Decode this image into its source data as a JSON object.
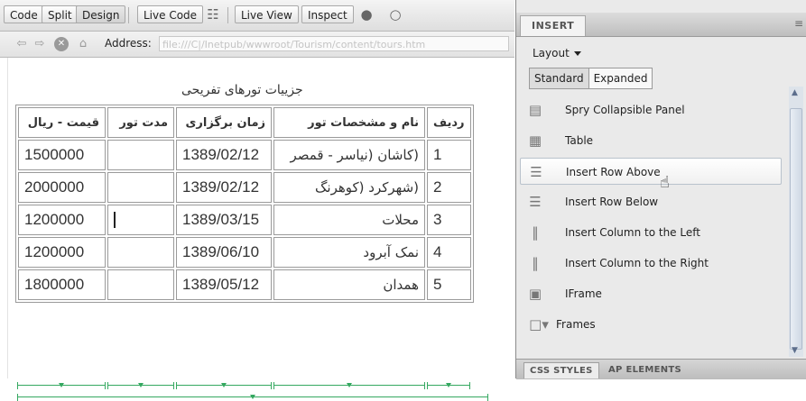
{
  "toolbar": {
    "buttons": [
      "Code",
      "Split",
      "Design",
      "Live Code",
      "Live View",
      "Inspect"
    ],
    "icons": [
      "file-status-icon",
      "globe-icon",
      "visual-aids-icon"
    ]
  },
  "address": {
    "label": "Address:",
    "value": "file:///C|/Inetpub/wwwroot/Tourism/content/tours.htm"
  },
  "page": {
    "caption": "جزییات تورهای تفریحی",
    "table": {
      "headers": [
        "قیمت - ریال",
        "مدت تور",
        "زمان برگزاری",
        "نام و مشخصات تور",
        "ردیف"
      ],
      "rows": [
        [
          "1500000",
          "",
          "1389/02/12",
          "(کاشان (نیاسر - قمصر",
          "1"
        ],
        [
          "2000000",
          "",
          "1389/02/12",
          "(شهرکرد (کوهرنگ",
          "2"
        ],
        [
          "1200000",
          "",
          "1389/03/15",
          "محلات",
          "3"
        ],
        [
          "1200000",
          "",
          "1389/06/10",
          "نمک آبرود",
          "4"
        ],
        [
          "1800000",
          "",
          "1389/05/12",
          "همدان",
          "5"
        ]
      ]
    }
  },
  "panel": {
    "title": "INSERT",
    "layout_menu": "Layout",
    "mode_tabs": [
      "Standard",
      "Expanded"
    ],
    "selected_mode": "Standard",
    "items": [
      {
        "label": "Spry Collapsible Panel",
        "icon": "spry-collapsible-panel-icon"
      },
      {
        "label": "Table",
        "icon": "table-icon"
      },
      {
        "label": "Insert Row Above",
        "icon": "insert-row-above-icon"
      },
      {
        "label": "Insert Row Below",
        "icon": "insert-row-below-icon"
      },
      {
        "label": "Insert Column to the Left",
        "icon": "insert-column-left-icon"
      },
      {
        "label": "Insert Column to the Right",
        "icon": "insert-column-right-icon"
      },
      {
        "label": "IFrame",
        "icon": "iframe-icon"
      },
      {
        "label": "Frames",
        "icon": "frames-icon"
      }
    ],
    "hovered_item": "Insert Row Above",
    "footer_tabs": [
      "CSS STYLES",
      "AP ELEMENTS"
    ]
  }
}
